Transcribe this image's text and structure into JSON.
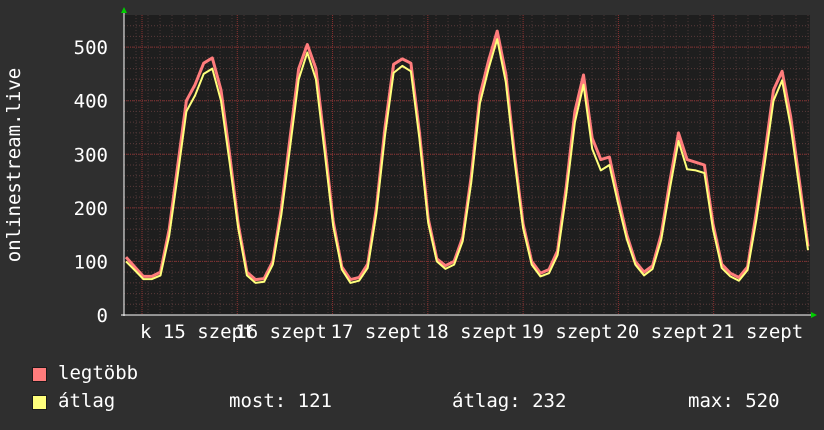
{
  "chart_data": {
    "type": "line",
    "ylabel": "onlinestream.live",
    "ylim": [
      0,
      560
    ],
    "y_ticks": [
      "0",
      "100",
      "200",
      "300",
      "400",
      "500"
    ],
    "x_tick_labels": [
      "k 15 szept",
      "16 szept",
      "17 szept",
      "18 szept",
      "19 szept",
      "20 szept",
      "21 szept"
    ],
    "series": [
      {
        "name": "legtöbb",
        "color": "#ff7c7c",
        "values": [
          108,
          90,
          72,
          72,
          80,
          160,
          280,
          400,
          430,
          470,
          480,
          420,
          300,
          170,
          80,
          66,
          68,
          100,
          200,
          330,
          460,
          505,
          460,
          320,
          175,
          90,
          66,
          70,
          95,
          200,
          350,
          468,
          478,
          470,
          340,
          180,
          105,
          92,
          100,
          145,
          260,
          410,
          475,
          530,
          450,
          300,
          170,
          100,
          78,
          85,
          120,
          240,
          380,
          448,
          330,
          290,
          295,
          220,
          150,
          100,
          80,
          92,
          150,
          250,
          340,
          290,
          285,
          280,
          170,
          95,
          78,
          70,
          90,
          190,
          300,
          420,
          455,
          370,
          250,
          128
        ]
      },
      {
        "name": "átlag",
        "color": "#ffff7c",
        "values": [
          100,
          84,
          67,
          67,
          74,
          148,
          262,
          380,
          410,
          450,
          460,
          400,
          285,
          162,
          74,
          60,
          62,
          94,
          188,
          312,
          440,
          490,
          440,
          305,
          166,
          85,
          60,
          64,
          88,
          190,
          335,
          452,
          465,
          455,
          328,
          172,
          100,
          86,
          94,
          138,
          248,
          395,
          460,
          515,
          435,
          288,
          162,
          94,
          72,
          78,
          112,
          226,
          360,
          430,
          310,
          270,
          280,
          208,
          142,
          94,
          74,
          86,
          140,
          236,
          325,
          272,
          270,
          265,
          160,
          88,
          72,
          64,
          84,
          176,
          284,
          400,
          438,
          352,
          236,
          121
        ]
      }
    ],
    "grid": true
  },
  "legend": {
    "items": [
      {
        "label": "legtöbb",
        "color": "#ff7c7c"
      },
      {
        "label": "átlag",
        "color": "#ffff7c"
      }
    ],
    "stats": {
      "now": "most: 121",
      "avg": "átlag: 232",
      "max": "max: 520"
    }
  }
}
